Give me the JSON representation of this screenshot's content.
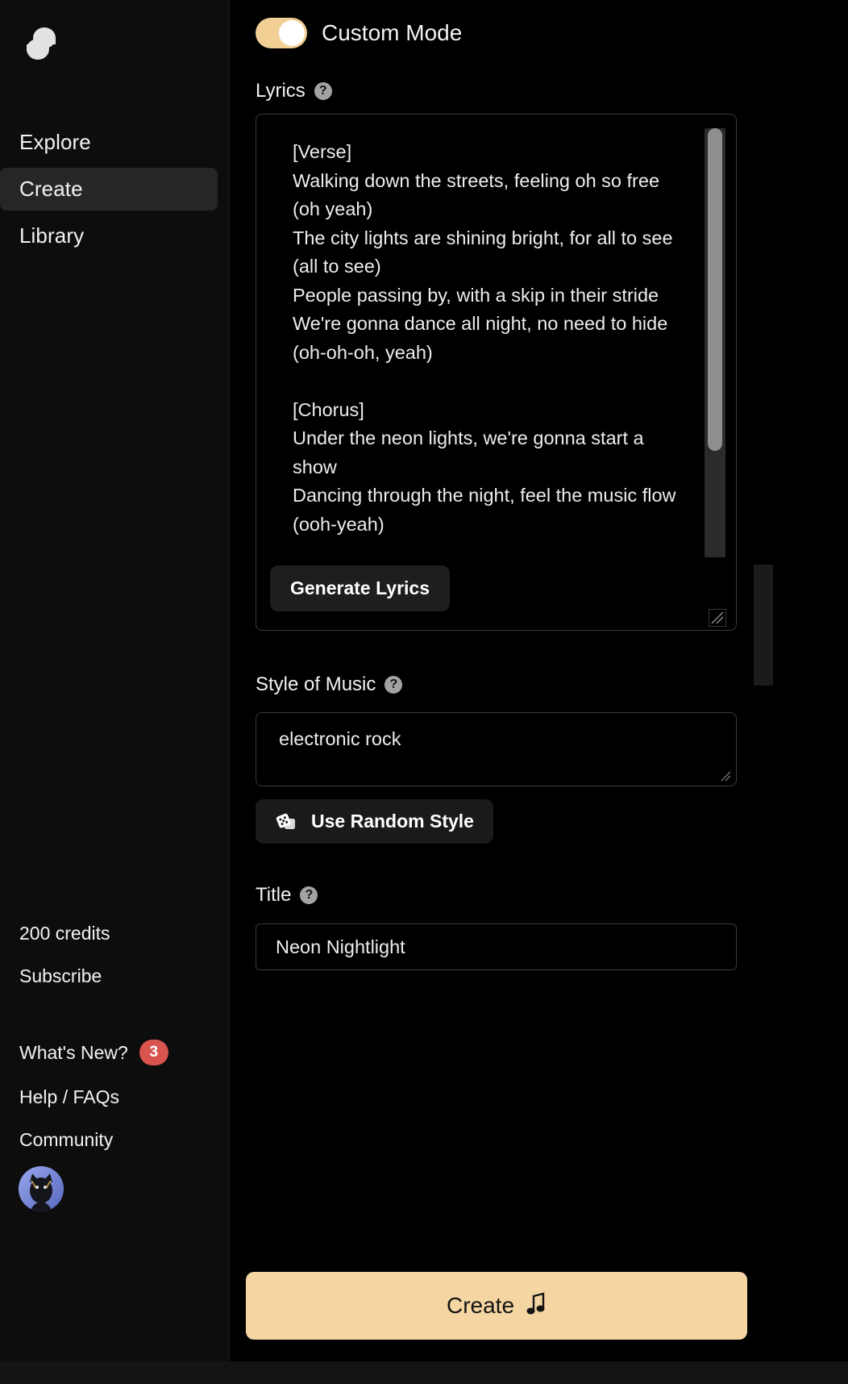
{
  "app": {
    "logo_name": "suno-logo"
  },
  "sidebar": {
    "nav": [
      {
        "label": "Explore",
        "name": "explore"
      },
      {
        "label": "Create",
        "name": "create"
      },
      {
        "label": "Library",
        "name": "library"
      }
    ],
    "credits": "200 credits",
    "subscribe": "Subscribe",
    "whats_new": {
      "label": "What's New?",
      "badge": "3",
      "badge_color": "#d9544f"
    },
    "help": "Help / FAQs",
    "community": "Community",
    "avatar_name": "user-avatar"
  },
  "main": {
    "custom_mode": {
      "label": "Custom Mode",
      "enabled": true,
      "on_color": "#f2cf94"
    },
    "lyrics": {
      "label": "Lyrics",
      "help": "?",
      "value": "[Verse]\nWalking down the streets, feeling oh so free (oh yeah)\nThe city lights are shining bright, for all to see (all to see)\nPeople passing by, with a skip in their stride\nWe're gonna dance all night, no need to hide (oh-oh-oh, yeah)\n\n[Chorus]\nUnder the neon lights, we're gonna start a show\nDancing through the night, feel the music flow (ooh-yeah)",
      "generate_button": "Generate Lyrics"
    },
    "style": {
      "label": "Style of Music",
      "help": "?",
      "value": "electronic rock",
      "random_button": "Use Random Style"
    },
    "title": {
      "label": "Title",
      "help": "?",
      "value": "Neon Nightlight"
    },
    "create_button": {
      "label": "Create",
      "icon": "music-note",
      "color": "#f5d5a2"
    }
  }
}
